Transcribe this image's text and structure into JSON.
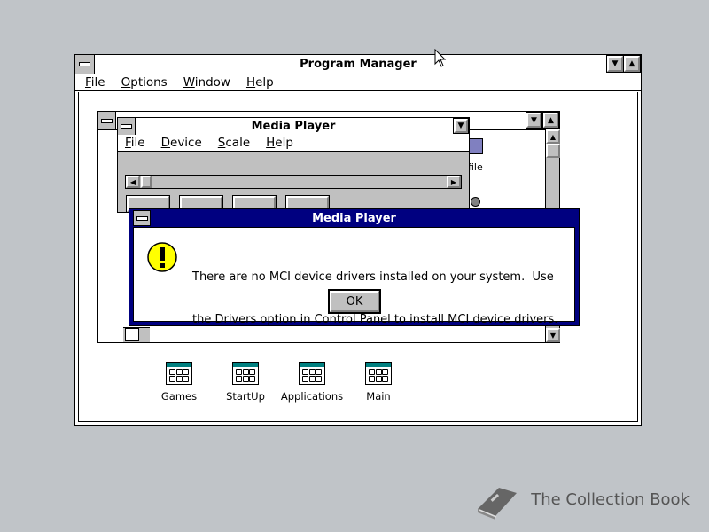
{
  "program_manager": {
    "title": "Program Manager",
    "menu": [
      "File",
      "Options",
      "Window",
      "Help"
    ]
  },
  "media_player_window": {
    "title": "Media Player",
    "menu": [
      "File",
      "Device",
      "Scale",
      "Help"
    ]
  },
  "background_group": {
    "partial_label": "dfile"
  },
  "dialog": {
    "title": "Media Player",
    "message_line1": "There are no MCI device drivers installed on your system.  Use",
    "message_line2": "the Drivers option in Control Panel to install MCI device drivers.",
    "ok_label": "OK"
  },
  "groups": [
    {
      "label": "Games"
    },
    {
      "label": "StartUp"
    },
    {
      "label": "Applications"
    },
    {
      "label": "Main"
    }
  ],
  "watermark": {
    "text": "The Collection Book"
  },
  "colors": {
    "active_title": "#000080",
    "desktop": "#c0c4c8",
    "face": "#c0c0c0"
  }
}
